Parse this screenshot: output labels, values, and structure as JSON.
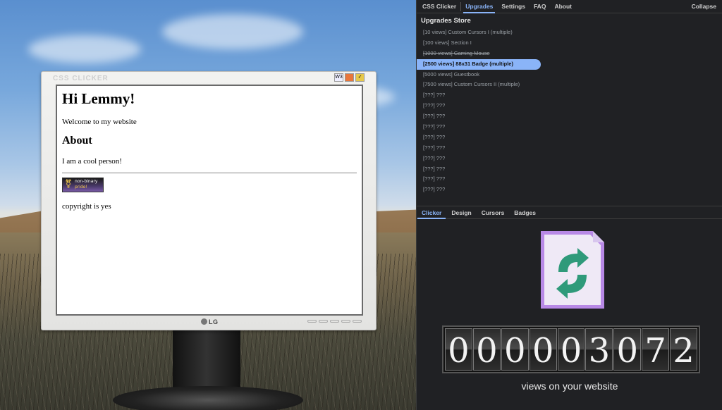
{
  "monitor": {
    "title": "CSS CLICKER",
    "brand": "LG",
    "website": {
      "heading": "Hi Lemmy!",
      "welcome": "Welcome to my website",
      "about_heading": "About",
      "about_text": "I am a cool person!",
      "badge_line1": "non-binary",
      "badge_line2": "pride!",
      "footer": "copyright is yes"
    }
  },
  "panel": {
    "tabs": [
      {
        "label": "CSS Clicker",
        "active": false
      },
      {
        "label": "Upgrades",
        "active": true
      },
      {
        "label": "Settings",
        "active": false
      },
      {
        "label": "FAQ",
        "active": false
      },
      {
        "label": "About",
        "active": false
      }
    ],
    "collapse_label": "Collapse",
    "store_title": "Upgrades Store",
    "upgrades": [
      {
        "label": "[10 views] Custom Cursors I (multiple)",
        "state": "available"
      },
      {
        "label": "[100 views] Section I",
        "state": "available"
      },
      {
        "label": "[1000 views] Gaming Mouse",
        "state": "bought"
      },
      {
        "label": "[2500 views] 88x31 Badge (multiple)",
        "state": "selected"
      },
      {
        "label": "[5000 views] Guestbook",
        "state": "available"
      },
      {
        "label": "[7500 views] Custom Cursors II (multiple)",
        "state": "available"
      },
      {
        "label": "[???] ???",
        "state": "locked"
      },
      {
        "label": "[???] ???",
        "state": "locked"
      },
      {
        "label": "[???] ???",
        "state": "locked"
      },
      {
        "label": "[???] ???",
        "state": "locked"
      },
      {
        "label": "[???] ???",
        "state": "locked"
      },
      {
        "label": "[???] ???",
        "state": "locked"
      },
      {
        "label": "[???] ???",
        "state": "locked"
      },
      {
        "label": "[???] ???",
        "state": "locked"
      },
      {
        "label": "[???] ???",
        "state": "locked"
      },
      {
        "label": "[???] ???",
        "state": "locked"
      }
    ],
    "sub_tabs": [
      {
        "label": "Clicker",
        "active": true
      },
      {
        "label": "Design",
        "active": false
      },
      {
        "label": "Cursors",
        "active": false
      },
      {
        "label": "Badges",
        "active": false
      }
    ],
    "counter_digits": [
      "0",
      "0",
      "0",
      "0",
      "0",
      "3",
      "0",
      "7",
      "2"
    ],
    "views_label": "views on your website",
    "colors": {
      "accent": "#8ab4f8",
      "panel_bg": "#202124"
    },
    "icon": "refresh-file-icon"
  }
}
